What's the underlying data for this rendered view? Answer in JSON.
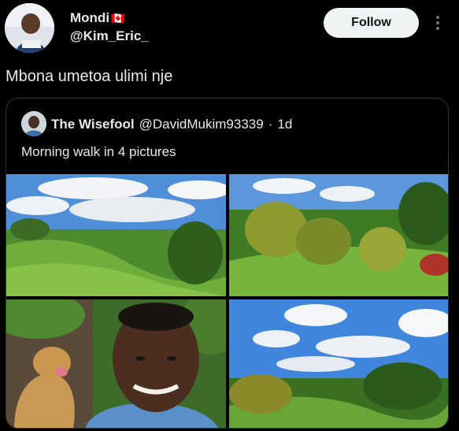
{
  "author": {
    "display_name": "Mondi",
    "flag": "🇨🇦",
    "handle": "@Kim_Eric_"
  },
  "follow_button": {
    "label": "Follow"
  },
  "tweet": {
    "text": "Mbona umetoa ulimi nje"
  },
  "quoted": {
    "display_name": "The Wisefool",
    "handle": "@DavidMukim93339",
    "separator": "·",
    "time": "1d",
    "text": "Morning walk in 4 pictures"
  },
  "icons": {
    "more": "more-vertical-icon"
  },
  "colors": {
    "background": "#000000",
    "text": "#e7e9ea",
    "follow_bg": "#eff3f4",
    "border": "#2f3336"
  }
}
